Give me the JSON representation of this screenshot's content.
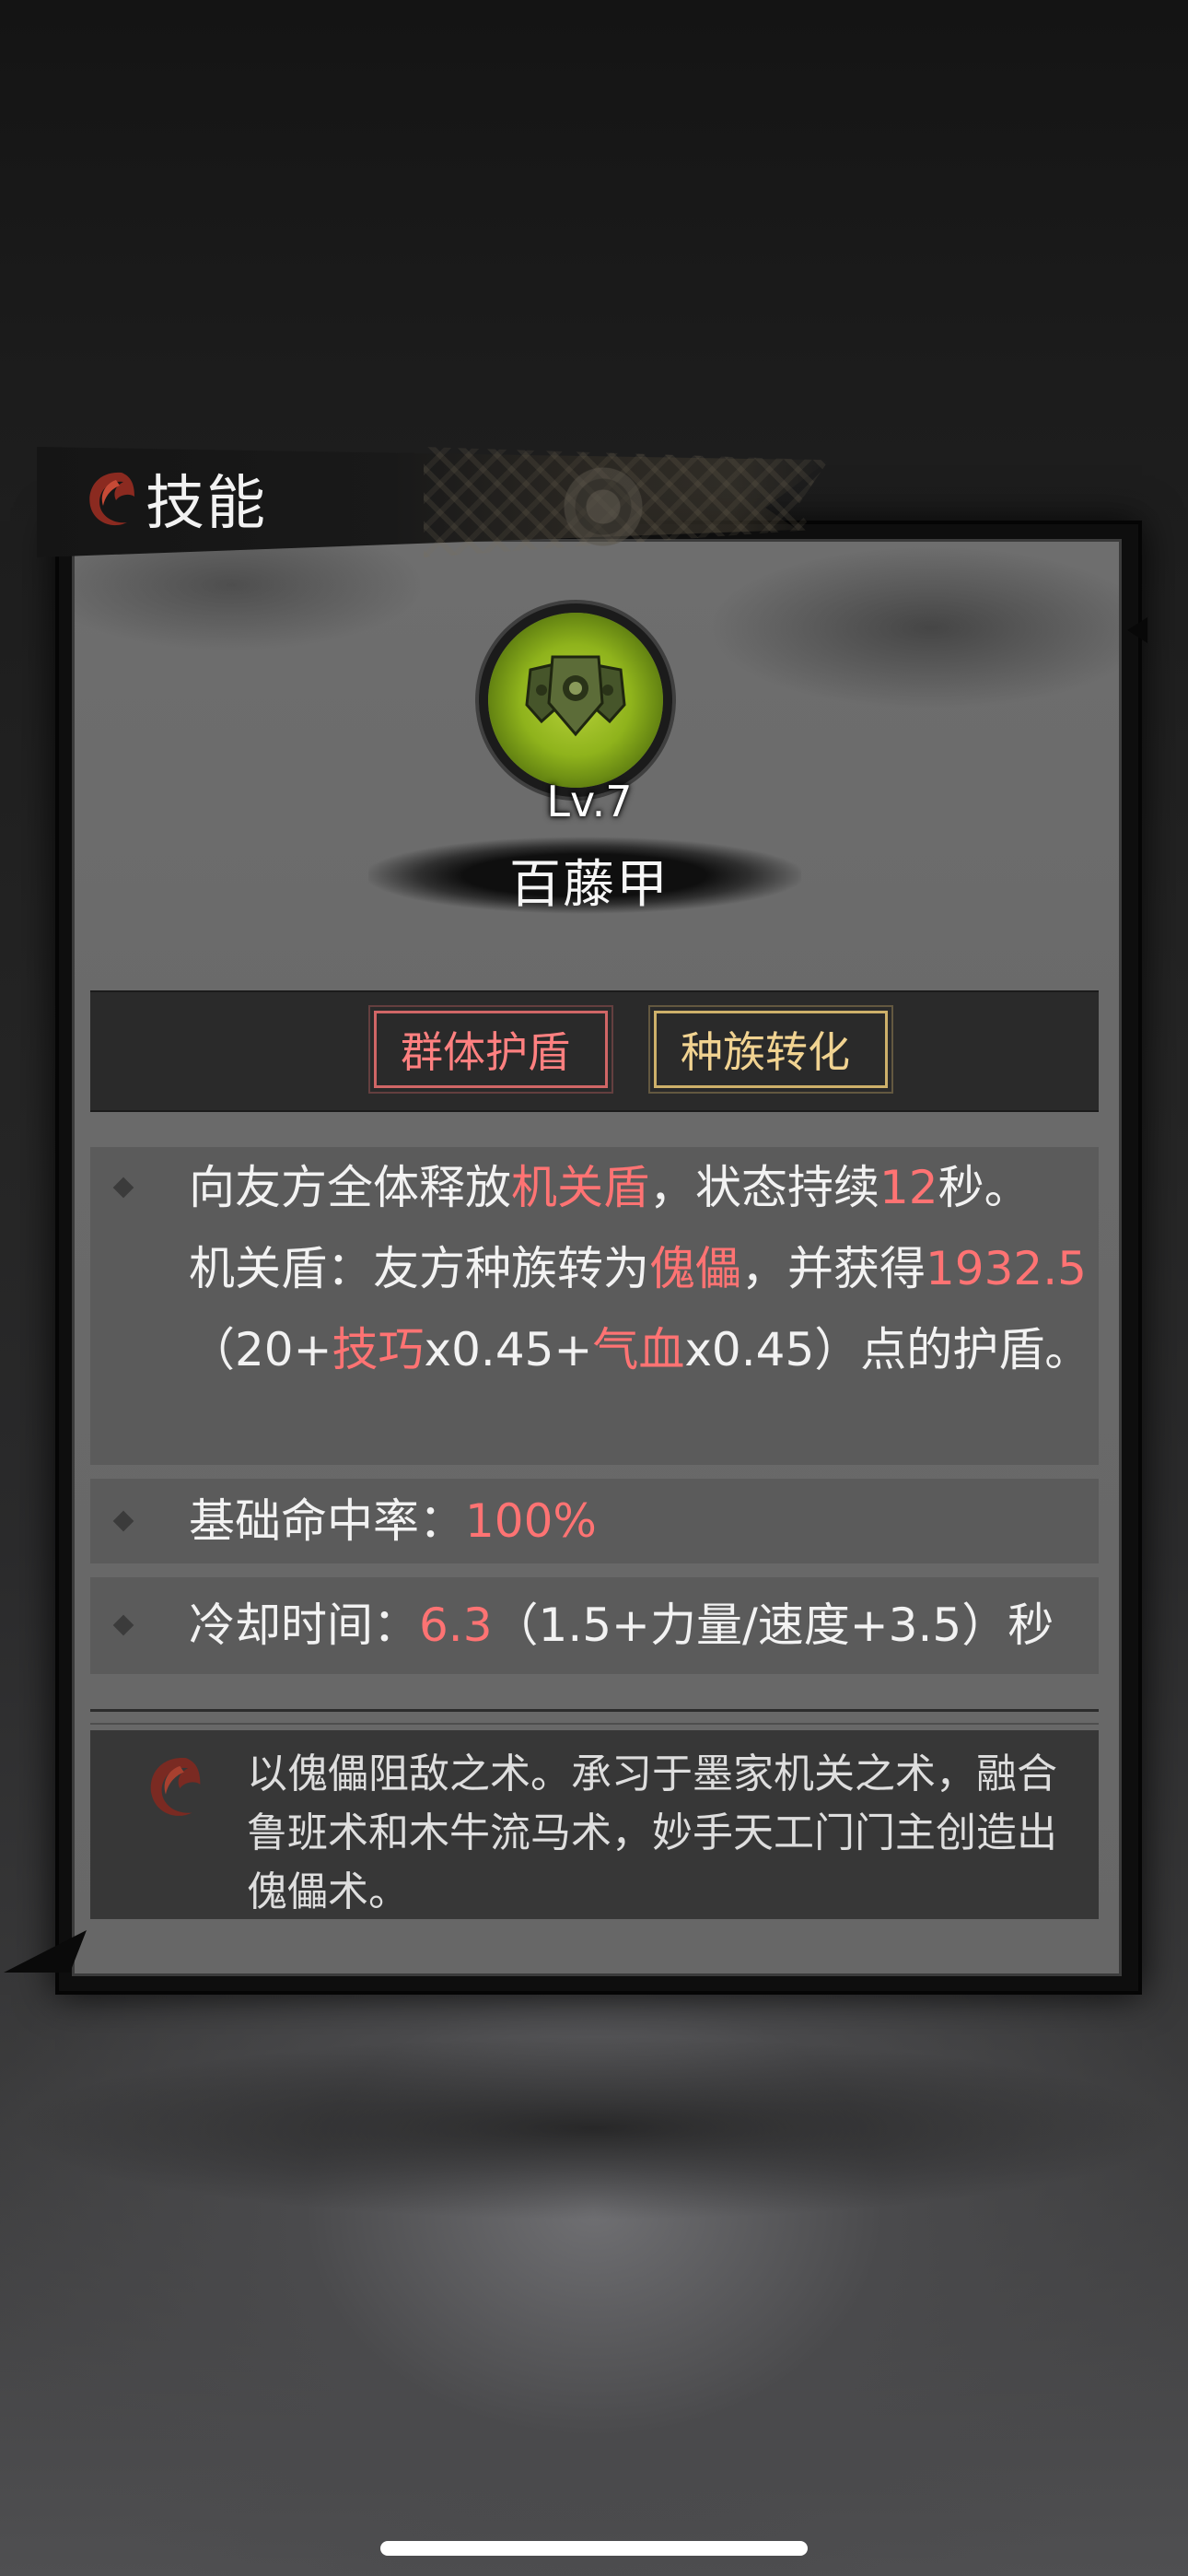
{
  "panel": {
    "title": "技能",
    "level_text": "Lv.7",
    "skill_name": "百藤甲",
    "icon": "shield-cluster-icon"
  },
  "tags": [
    "群体护盾",
    "种族转化"
  ],
  "description": {
    "p1": "向友方全体释放",
    "p1_hl": "机关盾",
    "p2": "，状态持续",
    "p2_hl": "12",
    "p3": "秒。",
    "p4": "机关盾：友方种族转为",
    "p4_hl": "傀儡",
    "p5": "，并获得",
    "p5_hl": "1932.5",
    "p6": "（20+",
    "p6_hl": "技巧",
    "p7": "x0.45+",
    "p7_hl": "气血",
    "p8": "x0.45）点的护盾。"
  },
  "hit_rate": {
    "label": "基础命中率：",
    "value": "100%"
  },
  "cooldown": {
    "label": "冷却时间：",
    "value": "6.3",
    "formula": "（1.5+力量/速度+3.5）秒"
  },
  "lore": "以傀儡阻敌之术。承习于墨家机关之术，融合鲁班术和木牛流马术，妙手天工门门主创造出傀儡术。",
  "colors": {
    "highlight_red": "#ff7373",
    "tag_red": "#ff8080",
    "tag_gold": "#f1d391",
    "icon_green": "#8fb31c"
  }
}
